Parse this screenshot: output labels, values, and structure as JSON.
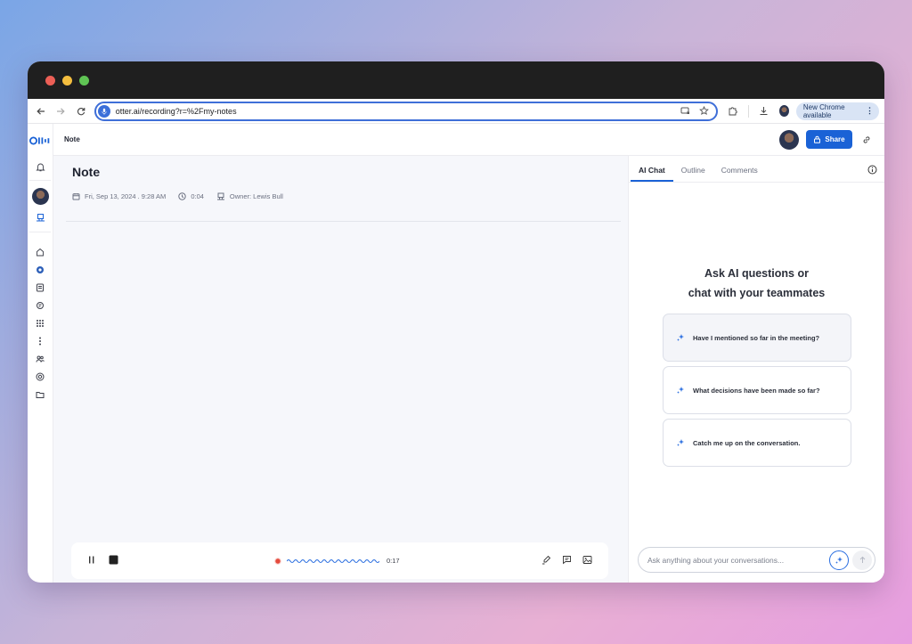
{
  "browser": {
    "url": "otter.ai/recording?r=%2Fmy-notes",
    "update_chip": "New Chrome available"
  },
  "topbar": {
    "breadcrumb": "Note",
    "share_label": "Share"
  },
  "note": {
    "title": "Note",
    "date": "Fri, Sep 13, 2024 . 9:28 AM",
    "duration": "0:04",
    "owner": "Owner: Lewis Bull"
  },
  "player": {
    "elapsed": "0:17"
  },
  "side": {
    "tabs": [
      "AI Chat",
      "Outline",
      "Comments"
    ],
    "heading_line1": "Ask AI questions or",
    "heading_line2": "chat with your teammates",
    "suggestions": [
      "Have I mentioned so far in the meeting?",
      "What decisions have been made so far?",
      "Catch me up on the conversation."
    ],
    "chat_placeholder": "Ask anything about your conversations..."
  },
  "colors": {
    "accent": "#1a62d6",
    "mac_red": "#ec5f56",
    "mac_yellow": "#f4be3f",
    "mac_green": "#5fc454"
  }
}
